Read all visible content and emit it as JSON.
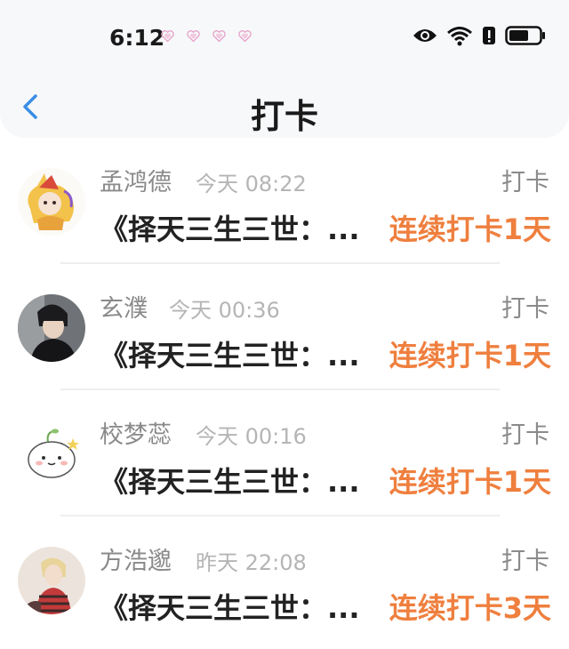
{
  "status_bar": {
    "time": "6:12",
    "icons": [
      "heart-icon",
      "heart-icon",
      "heart-icon",
      "heart-icon",
      "eye-icon",
      "wifi-icon",
      "alert-icon",
      "battery-icon"
    ]
  },
  "header": {
    "title": "打卡"
  },
  "colors": {
    "accent_blue": "#3a8ee6",
    "streak_orange": "#ef7f3e"
  },
  "list": [
    {
      "name": "孟鸿德",
      "time": "今天 08:22",
      "action": "打卡",
      "book": "《择天三生三世：...",
      "streak": "连续打卡1天"
    },
    {
      "name": "玄濮",
      "time": "今天 00:36",
      "action": "打卡",
      "book": "《择天三生三世：...",
      "streak": "连续打卡1天"
    },
    {
      "name": "校梦蕊",
      "time": "今天 00:16",
      "action": "打卡",
      "book": "《择天三生三世：...",
      "streak": "连续打卡1天"
    },
    {
      "name": "方浩邈",
      "time": "昨天 22:08",
      "action": "打卡",
      "book": "《择天三生三世：...",
      "streak": "连续打卡3天"
    }
  ]
}
